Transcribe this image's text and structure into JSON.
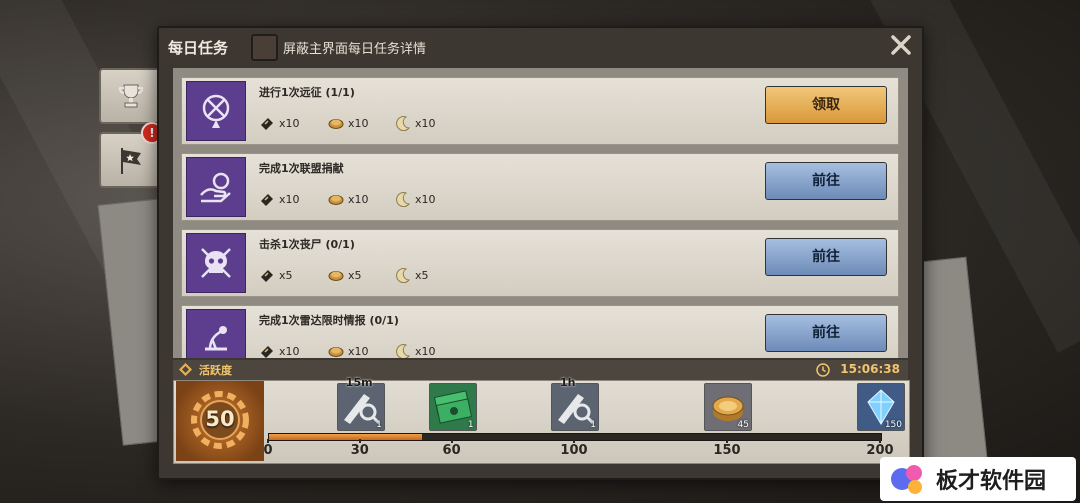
{
  "dialog": {
    "title": "每日任务",
    "hide_label": "屏蔽主界面每日任务详情"
  },
  "side_tabs": [
    {
      "icon": "trophy-icon"
    },
    {
      "icon": "flag-icon",
      "badge": "!"
    }
  ],
  "tasks": [
    {
      "name": "进行1次远征 (1/1)",
      "icon": "expedition-icon",
      "rewards": [
        {
          "icon": "ticket-icon",
          "amount": "x10"
        },
        {
          "icon": "coin-icon",
          "amount": "x10"
        },
        {
          "icon": "moon-icon",
          "amount": "x10"
        }
      ],
      "button": "领取",
      "button_state": "claim"
    },
    {
      "name": "完成1次联盟捐献",
      "icon": "donate-icon",
      "rewards": [
        {
          "icon": "ticket-icon",
          "amount": "x10"
        },
        {
          "icon": "coin-icon",
          "amount": "x10"
        },
        {
          "icon": "moon-icon",
          "amount": "x10"
        }
      ],
      "button": "前往",
      "button_state": "go"
    },
    {
      "name": "击杀1次丧尸 (0/1)",
      "icon": "skull-icon",
      "rewards": [
        {
          "icon": "ticket-icon",
          "amount": "x5"
        },
        {
          "icon": "coin-icon",
          "amount": "x5"
        },
        {
          "icon": "moon-icon",
          "amount": "x5"
        }
      ],
      "button": "前往",
      "button_state": "go"
    },
    {
      "name": "完成1次雷达限时情报 (0/1)",
      "icon": "radar-icon",
      "rewards": [
        {
          "icon": "ticket-icon",
          "amount": "x10"
        },
        {
          "icon": "coin-icon",
          "amount": "x10"
        },
        {
          "icon": "moon-icon",
          "amount": "x10"
        }
      ],
      "button": "前往",
      "button_state": "go"
    }
  ],
  "activity": {
    "label": "活跃度",
    "timer": "15:06:38",
    "score": "50",
    "max": 200,
    "ticks": [
      "0",
      "30",
      "60",
      "100",
      "150",
      "200"
    ],
    "rewards": [
      {
        "time": "15m",
        "count": "1",
        "icon": "speedup-icon",
        "threshold": 30
      },
      {
        "time": "",
        "count": "1",
        "icon": "cash-icon",
        "threshold": 60
      },
      {
        "time": "1h",
        "count": "1",
        "icon": "speedup-icon",
        "threshold": 100
      },
      {
        "time": "",
        "count": "45",
        "icon": "gold-coin-icon",
        "threshold": 150
      },
      {
        "time": "",
        "count": "150",
        "icon": "crystal-icon",
        "threshold": 200
      }
    ]
  },
  "watermark": {
    "text": "板才软件园"
  }
}
